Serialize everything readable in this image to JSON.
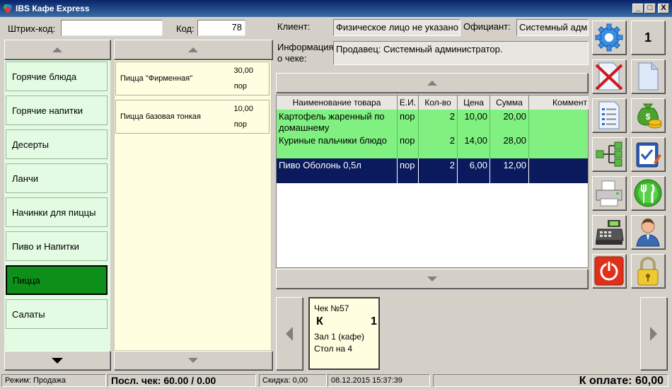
{
  "window": {
    "title": "IBS Кафе Express",
    "min": "_",
    "max": "□",
    "close": "X"
  },
  "barcode": {
    "label": "Штрих-код:",
    "value": ""
  },
  "code": {
    "label": "Код:",
    "value": "78"
  },
  "client": {
    "label": "Клиент:",
    "value": "Физическое лицо не указано"
  },
  "waiter": {
    "label": "Официант:",
    "value": "Системный адми"
  },
  "receipt_info": {
    "label_line1": "Информация",
    "label_line2": "о чеке:",
    "value": "Продавец: Системный администратор."
  },
  "categories": [
    "Горячие блюда",
    "Горячие напитки",
    "Десерты",
    "Ланчи",
    "Начинки для пиццы",
    "Пиво и Напитки",
    "Пицца",
    "Салаты"
  ],
  "active_category": "Пицца",
  "products": [
    {
      "name": "Пицца \"Фирменная\"",
      "price": "30,00",
      "unit": "пор"
    },
    {
      "name": "Пицца базовая тонкая",
      "price": "10,00",
      "unit": "пор"
    }
  ],
  "order_table": {
    "columns": [
      "Наименование товара",
      "Е.И.",
      "Кол-во",
      "Цена",
      "Сумма",
      "Коммент"
    ],
    "rows": [
      {
        "name": "Картофель жаренный по домашнему",
        "unit": "пор",
        "qty": "2",
        "price": "10,00",
        "sum": "20,00"
      },
      {
        "name": "Куриные пальчики блюдо",
        "unit": "пор",
        "qty": "2",
        "price": "14,00",
        "sum": "28,00"
      },
      {
        "name": "Пиво Оболонь 0,5л",
        "unit": "пор",
        "qty": "2",
        "price": "6,00",
        "sum": "12,00"
      }
    ]
  },
  "check_card": {
    "title": "Чек №57",
    "letter": "К",
    "number": "1",
    "hall": "Зал 1 (кафе)",
    "table": "Стол на 4"
  },
  "tool_buttons": {
    "counter": "1"
  },
  "statusbar": {
    "mode": "Режим: Продажа",
    "last_check": "Посл. чек: 60.00 / 0.00",
    "discount": "Скидка: 0,00",
    "datetime": "08.12.2015 15:37:39",
    "to_pay": "К оплате: 60,00"
  },
  "colors": {
    "category_bg": "#e2fbe2",
    "category_active": "#0d8f1a",
    "product_bg": "#fffee0",
    "row_green": "#80f080",
    "row_selected": "#0a1a5c"
  }
}
